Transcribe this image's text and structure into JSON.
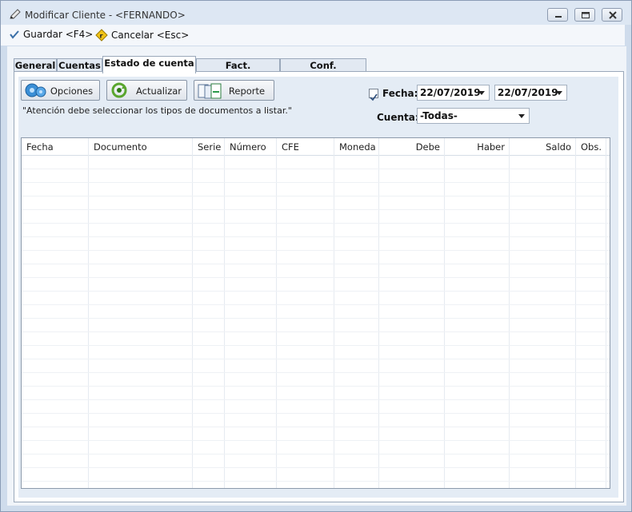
{
  "window": {
    "title": "Modificar Cliente - <FERNANDO>"
  },
  "toolbar": {
    "save_label": "Guardar <F4>",
    "cancel_label": "Cancelar <Esc>"
  },
  "tabs": [
    {
      "label": "General"
    },
    {
      "label": "Cuentas"
    },
    {
      "label": "Estado de cuenta"
    },
    {
      "label": "Fact. Pendientes"
    },
    {
      "label": "Conf. Electrónica"
    }
  ],
  "active_tab": "Estado de cuenta",
  "panel": {
    "buttons": {
      "options": "Opciones",
      "refresh": "Actualizar",
      "report": "Reporte"
    },
    "note": "\"Atención debe seleccionar los tipos de documentos a listar.\"",
    "fecha": {
      "label": "Fecha:",
      "checked": true,
      "from": "22/07/2019",
      "to": "22/07/2019"
    },
    "cuenta": {
      "label": "Cuenta:",
      "selected": "-Todas-"
    }
  },
  "grid": {
    "columns": [
      "Fecha",
      "Documento",
      "Serie",
      "Número",
      "CFE",
      "Moneda",
      "Debe",
      "Haber",
      "Saldo",
      "Obs."
    ],
    "rows": []
  },
  "colors": {
    "accent": "#cfdcec",
    "panel_bg": "#e4ecf5",
    "border": "#8d9aab"
  },
  "icons": [
    "pencil-icon",
    "minimize-icon",
    "maximize-icon",
    "close-icon",
    "checkmark-icon",
    "cancel-icon",
    "options-icon",
    "refresh-icon",
    "report-icon",
    "checkbox-icon",
    "dropdown-arrow-icon"
  ]
}
